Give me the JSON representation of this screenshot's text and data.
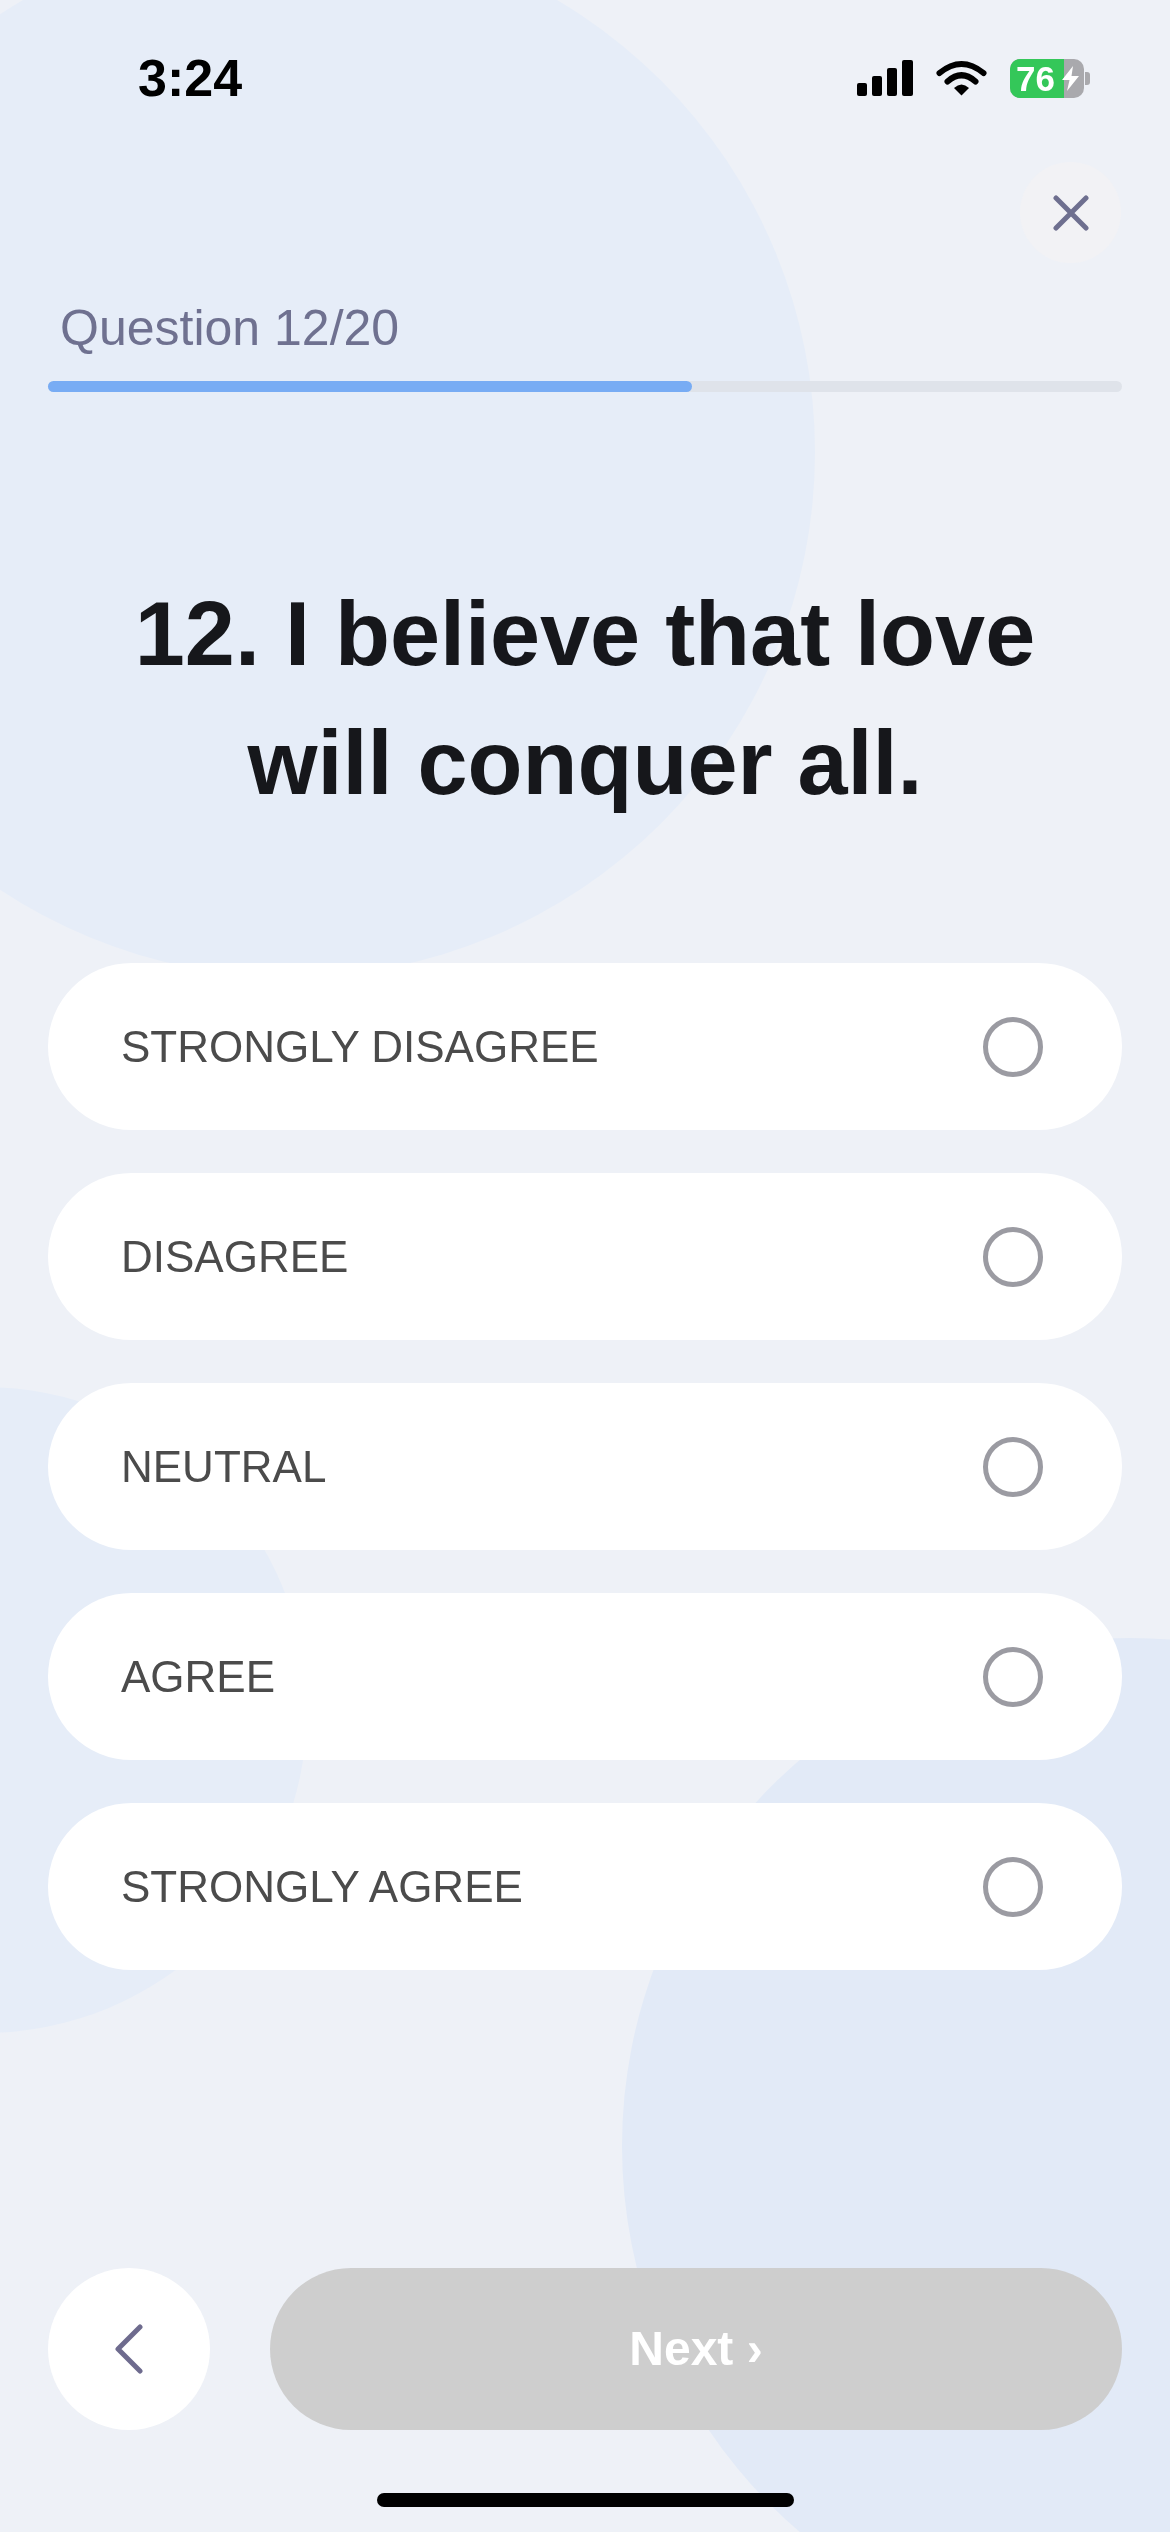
{
  "status_bar": {
    "time": "3:24",
    "battery": "76"
  },
  "progress": {
    "label": "Question 12/20",
    "level": 0.6
  },
  "question": "12. I believe that love will conquer all.",
  "options": [
    {
      "label": "STRONGLY DISAGREE",
      "selected": false
    },
    {
      "label": "DISAGREE",
      "selected": false
    },
    {
      "label": "NEUTRAL",
      "selected": false
    },
    {
      "label": "AGREE",
      "selected": false
    },
    {
      "label": "STRONGLY AGREE",
      "selected": false
    }
  ],
  "navigation": {
    "next": {
      "label": "Next ›",
      "disabled": true
    }
  }
}
